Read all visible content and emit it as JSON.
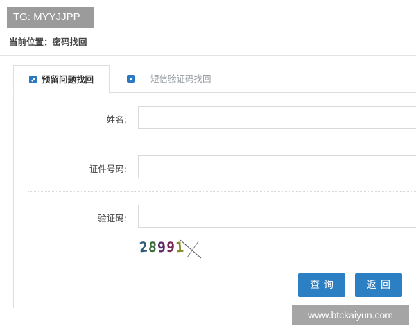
{
  "overlay": {
    "tg": "TG: MYYJJPP",
    "site": "www.btckaiyun.com"
  },
  "breadcrumb": {
    "text": "当前位置：密码找回"
  },
  "tabs": [
    {
      "label": "预留问题找回",
      "icon": "edit-icon",
      "active": true
    },
    {
      "label": "短信验证码找回",
      "icon": "phone-icon",
      "active": false
    }
  ],
  "form": {
    "name_label": "姓名:",
    "name_value": "",
    "id_label": "证件号码:",
    "id_value": "",
    "captcha_label": "验证码:",
    "captcha_value": "",
    "captcha_chars": [
      "2",
      "8",
      "9",
      "9",
      "1"
    ]
  },
  "buttons": {
    "query": "查询",
    "back": "返回"
  },
  "colors": {
    "accent": "#2d7fc4",
    "overlay": "#9b9b9b"
  }
}
